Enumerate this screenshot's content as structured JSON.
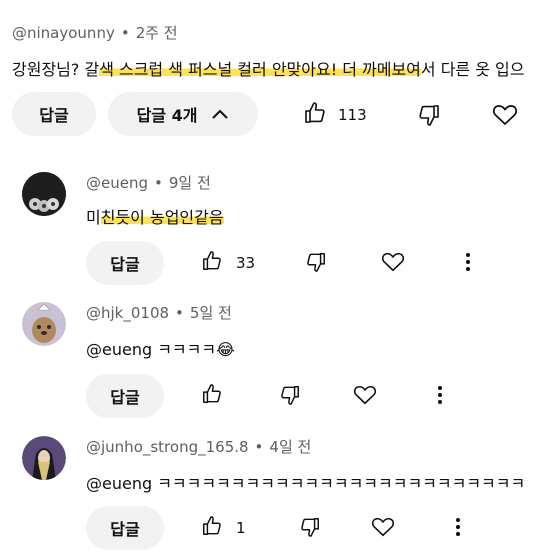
{
  "top_comment": {
    "handle": "@ninayounny",
    "time": "2주 전",
    "text_pre": "강원장님? 갈",
    "text_hl": "색 스크럽 색 퍼스널 컬러 안맞아요! 더 까메보여",
    "text_post": "서 다른 옷 입으",
    "reply_label": "답글",
    "replies_toggle_label": "답글 4개",
    "like_count": "113"
  },
  "replies": [
    {
      "handle": "@eueng",
      "time": "9일 전",
      "text_pre": "미",
      "text_hl": "친듯이 농업인같음",
      "text_post": "",
      "reply_label": "답글",
      "like_count": "33"
    },
    {
      "handle": "@hjk_0108",
      "time": "5일 전",
      "text": "@eueng ㅋㅋㅋㅋ",
      "emoji": "😂",
      "reply_label": "답글",
      "like_count": ""
    },
    {
      "handle": "@junho_strong_165.8",
      "time": "4일 전",
      "text": "@eueng ㅋㅋㅋㅋㅋㅋㅋㅋㅋㅋㅋㅋㅋㅋㅋㅋㅋㅋㅋㅋㅋㅋㅋㅋㅋ",
      "reply_label": "답글",
      "like_count": "1"
    }
  ],
  "separator": "•"
}
